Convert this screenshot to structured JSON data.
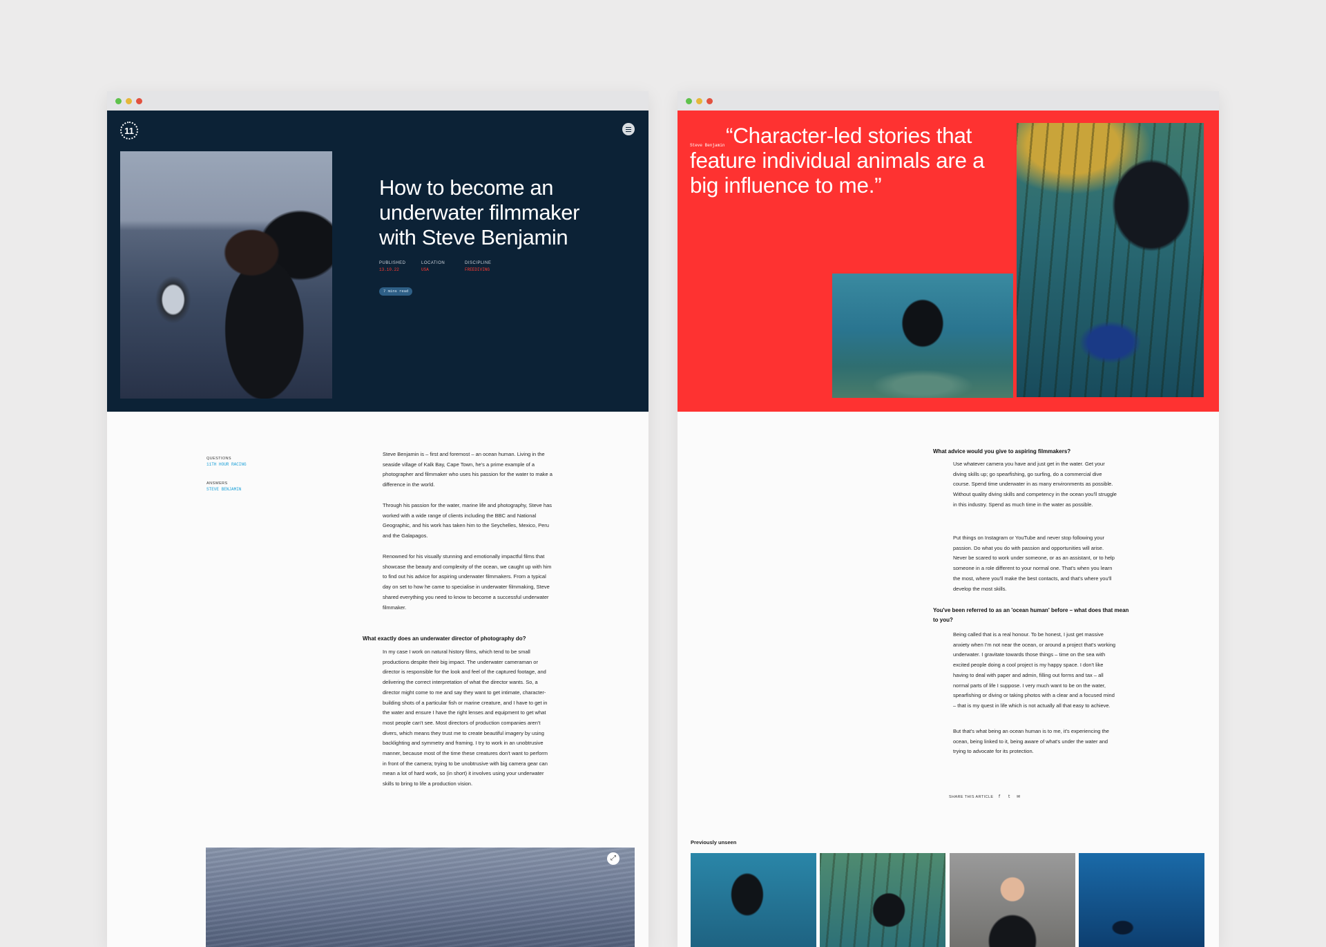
{
  "left_page": {
    "logo_text": "11",
    "title": "How to become an underwater filmmaker with Steve Benjamin",
    "meta": [
      {
        "label": "PUBLISHED",
        "value": "13.10.22"
      },
      {
        "label": "LOCATION",
        "value": "USA"
      },
      {
        "label": "DISCIPLINE",
        "value": "FREEDIVING"
      }
    ],
    "read_time": "7 mins read",
    "sidebar": {
      "questions_label": "QUESTIONS",
      "questions_value": "11TH HOUR RACING",
      "answers_label": "ANSWERS",
      "answers_value": "STEVE BENJAMIN"
    },
    "intro": [
      "Steve Benjamin is – first and foremost – an ocean human. Living in the seaside village of Kalk Bay, Cape Town, he's a prime example of a photographer and filmmaker who uses his passion for the water to make a difference in the world.",
      "Through his passion for the water, marine life and photography, Steve has worked with a wide range of clients including the BBC and National Geographic, and his work has taken him to the Seychelles, Mexico, Peru and the Galapagos.",
      "Renowned for his visually stunning and emotionally impactful films that showcase the beauty and complexity of the ocean, we caught up with him to find out his advice for aspiring underwater filmmakers. From a typical day on set to how he came to specialise in underwater filmmaking, Steve shared everything you need to know to become a successful underwater filmmaker."
    ],
    "question1": "What exactly does an underwater director of photography do?",
    "answer1": "In my case I work on natural history films, which tend to be small productions despite their big impact. The underwater cameraman or director is responsible for the look and feel of the captured footage, and delivering the correct interpretation of what the director wants. So, a director might come to me and say they want to get intimate, character-building shots of a particular fish or marine creature, and I have to get in the water and ensure I have the right lenses and equipment to get what most people can't see. Most directors of production companies aren't divers, which means they trust me to create beautiful imagery by using backlighting and symmetry and framing. I try to work in an unobtrusive manner, because most of the time these creatures don't want to perform in front of the camera; trying to be unobtrusive with big camera gear can mean a lot of hard work, so (in short) it involves using your underwater skills to bring to life a production vision."
  },
  "right_page": {
    "quote_credit": "Steve Benjamin",
    "quote": "“Character-led stories that feature individual animals are a big influence to me.”",
    "question2": "What advice would you give to aspiring filmmakers?",
    "answer2a": "Use whatever camera you have and just get in the water. Get your diving skills up; go spearfishing, go surfing, do a commercial dive course. Spend time underwater in as many environments as possible. Without quality diving skills and competency in the ocean you'll struggle in this industry. Spend as much time in the water as possible.",
    "answer2b": "Put things on Instagram or YouTube and never stop following your passion. Do what you do with passion and opportunities will arise. Never be scared to work under someone, or as an assistant, or to help someone in a role different to your normal one. That's when you learn the most, where you'll make the best contacts, and that's where you'll develop the most skills.",
    "question3": "You've been referred to as an 'ocean human' before – what does that mean to you?",
    "answer3a": "Being called that is a real honour. To be honest, I just get massive anxiety when I'm not near the ocean, or around a project that's working underwater. I gravitate towards those things – time on the sea with excited people doing a cool project is my happy space. I don't like having to deal with paper and admin, filling out forms and tax – all normal parts of life I suppose. I very much want to be on the water, spearfishing or diving or taking photos with a clear and a focused mind – that is my quest in life which is not actually all that easy to achieve.",
    "answer3b": "But that's what being an ocean human is to me, it's experiencing the ocean, being linked to it, being aware of what's under the water and trying to advocate for its protection.",
    "share_label": "SHARE THIS ARTICLE",
    "share_icons": [
      "f",
      "t",
      "✉"
    ],
    "previously_unseen": "Previously unseen"
  }
}
